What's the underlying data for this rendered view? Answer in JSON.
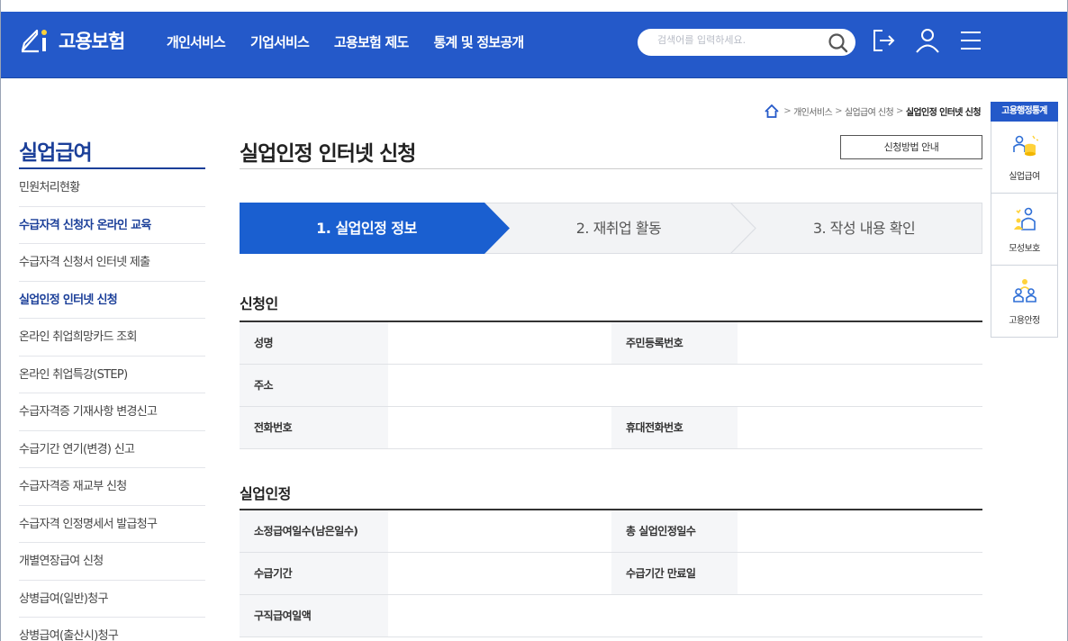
{
  "header": {
    "logo_text": "고용보험",
    "nav": [
      "개인서비스",
      "기업서비스",
      "고용보험 제도",
      "통계 및 정보공개"
    ],
    "search_placeholder": "검색어를 입력하세요.",
    "icons": [
      "search-icon",
      "logout-icon",
      "user-icon",
      "menu-icon"
    ],
    "color": "#2459c9"
  },
  "breadcrumb": {
    "items": [
      "개인서비스",
      "실업급여 신청"
    ],
    "current": "실업인정 인터넷 신청"
  },
  "sidebar": {
    "title": "실업급여",
    "items": [
      {
        "label": "민원처리현황",
        "strong": false
      },
      {
        "label": "수급자격 신청자 온라인 교육",
        "strong": true
      },
      {
        "label": "수급자격 신청서 인터넷 제출",
        "strong": false
      },
      {
        "label": "실업인정 인터넷 신청",
        "strong": true
      },
      {
        "label": "온라인 취업희망카드 조회",
        "strong": false
      },
      {
        "label": "온라인 취업특강(STEP)",
        "strong": false
      },
      {
        "label": "수급자격증 기재사항 변경신고",
        "strong": false
      },
      {
        "label": "수급기간 연기(변경) 신고",
        "strong": false
      },
      {
        "label": "수급자격증 재교부 신청",
        "strong": false
      },
      {
        "label": "수급자격 인정명세서 발급청구",
        "strong": false
      },
      {
        "label": "개별연장급여 신청",
        "strong": false
      },
      {
        "label": "상병급여(일반)청구",
        "strong": false
      },
      {
        "label": "상병급여(출산시)청구",
        "strong": false
      }
    ]
  },
  "main": {
    "title": "실업인정 인터넷 신청",
    "guide_button": "신청방법 안내",
    "steps": [
      "1. 실업인정 정보",
      "2. 재취업 활동",
      "3. 작성 내용 확인"
    ],
    "active_step": 1,
    "sections": [
      {
        "title": "신청인",
        "rows": [
          {
            "label1": "성명",
            "label2": "주민등록번호"
          },
          {
            "label1": "주소",
            "label2": ""
          },
          {
            "label1": "전화번호",
            "label2": "휴대전화번호"
          }
        ]
      },
      {
        "title": "실업인정",
        "rows": [
          {
            "label1": "소정급여일수(남은일수)",
            "label2": "총 실업인정일수"
          },
          {
            "label1": "수급기간",
            "label2": "수급기간 만료일"
          },
          {
            "label1": "구직급여일액",
            "label2": ""
          }
        ]
      }
    ]
  },
  "quick_menu": {
    "title": "고용행정통계",
    "items": [
      {
        "label": "실업급여",
        "icon": "coins-person-icon"
      },
      {
        "label": "모성보호",
        "icon": "mother-child-icon"
      },
      {
        "label": "고용안정",
        "icon": "group-people-icon"
      }
    ]
  }
}
